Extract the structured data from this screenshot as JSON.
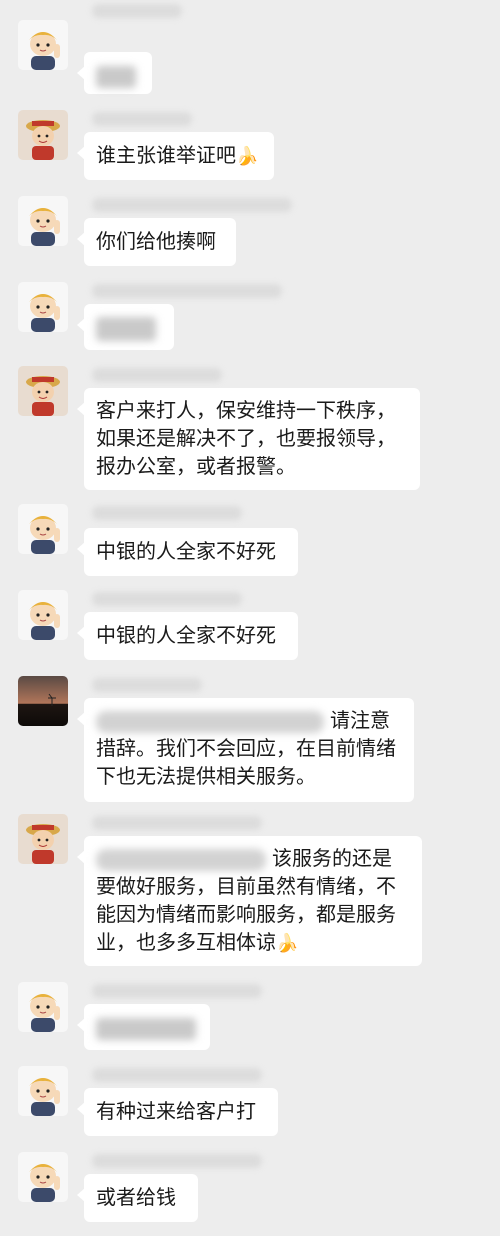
{
  "messages": [
    {
      "avatar": "cartoon-boy-icon",
      "redacted": true
    },
    {
      "avatar": "pirate-icon",
      "text": "谁主张谁举证吧",
      "emoji": "banana-icon"
    },
    {
      "avatar": "cartoon-boy-icon",
      "text": "你们给他揍啊"
    },
    {
      "avatar": "cartoon-boy-icon",
      "redacted": true
    },
    {
      "avatar": "pirate-icon",
      "lines": [
        "客户来打人，保安维持一下秩序，",
        "如果还是解决不了，也要报领导，",
        "报办公室，或者报警。"
      ]
    },
    {
      "avatar": "cartoon-boy-icon",
      "text": "中银的人全家不好死"
    },
    {
      "avatar": "cartoon-boy-icon",
      "text": "中银的人全家不好死"
    },
    {
      "avatar": "sunset-icon",
      "lines": [
        "请注意",
        "措辞。我们不会回应，在目前情绪",
        "下也无法提供相关服务。"
      ]
    },
    {
      "avatar": "pirate-icon",
      "lines": [
        "该服务的还是",
        "要做好服务，目前虽然有情绪，不",
        "能因为情绪而影响服务，都是服务",
        "业，也多多互相体谅"
      ],
      "emoji": "banana-icon"
    },
    {
      "avatar": "cartoon-boy-icon",
      "redacted": true
    },
    {
      "avatar": "cartoon-boy-icon",
      "text": "有种过来给客户打"
    },
    {
      "avatar": "cartoon-boy-icon",
      "text": "或者给钱"
    }
  ],
  "colors": {
    "background": "#ededed",
    "bubble": "#ffffff",
    "text": "#1a1a1a"
  }
}
